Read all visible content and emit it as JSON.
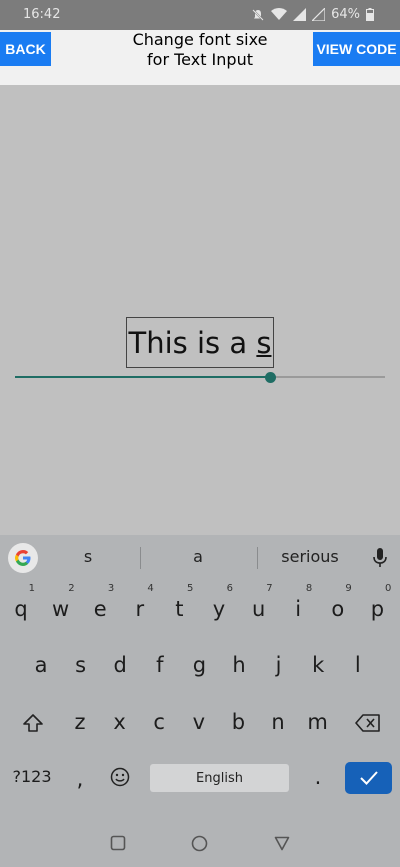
{
  "status_bar": {
    "time": "16:42",
    "battery": "64%"
  },
  "header": {
    "back_label": "BACK",
    "title_line1": "Change font sixe",
    "title_line2": "for Text Input",
    "view_code_label": "VIEW CODE"
  },
  "text_input": {
    "value_prefix": "This is a ",
    "value_composing": "s"
  },
  "slider": {
    "value_fraction": 0.69,
    "color": "#1f6d64"
  },
  "keyboard": {
    "suggestions": [
      "s",
      "a",
      "serious"
    ],
    "row1": [
      {
        "k": "q",
        "h": "1"
      },
      {
        "k": "w",
        "h": "2"
      },
      {
        "k": "e",
        "h": "3"
      },
      {
        "k": "r",
        "h": "4"
      },
      {
        "k": "t",
        "h": "5"
      },
      {
        "k": "y",
        "h": "6"
      },
      {
        "k": "u",
        "h": "7"
      },
      {
        "k": "i",
        "h": "8"
      },
      {
        "k": "o",
        "h": "9"
      },
      {
        "k": "p",
        "h": "0"
      }
    ],
    "row2": [
      "a",
      "s",
      "d",
      "f",
      "g",
      "h",
      "j",
      "k",
      "l"
    ],
    "row3": [
      "z",
      "x",
      "c",
      "v",
      "b",
      "n",
      "m"
    ],
    "symbols_label": "?123",
    "comma": ",",
    "space_label": "English",
    "period": ".",
    "accent_color": "#1661b8"
  },
  "colors": {
    "button_blue": "#1a7cf2"
  }
}
